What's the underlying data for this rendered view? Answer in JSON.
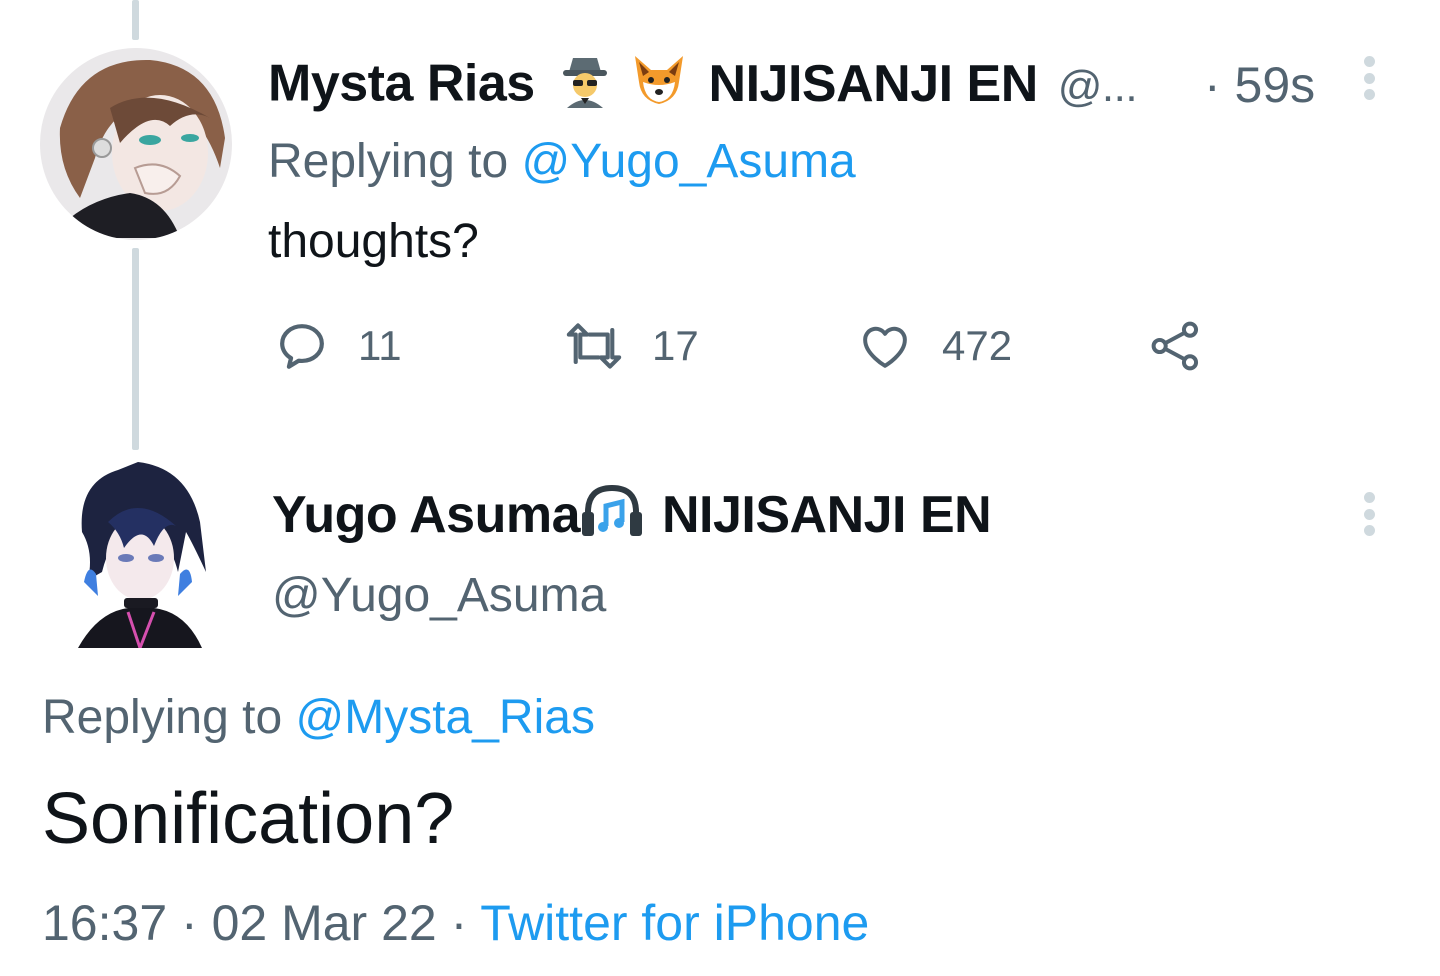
{
  "parent_tweet": {
    "display_name": "Mysta Rias",
    "org": "NIJISANJI EN",
    "handle_truncated": "@...",
    "time": "· 59s",
    "emoji_icons": [
      "detective-icon",
      "fox-face-icon"
    ],
    "replying_prefix": "Replying to",
    "replying_handle": "@Yugo_Asuma",
    "text": "thoughts?",
    "actions": {
      "replies": "11",
      "retweets": "17",
      "likes": "472"
    }
  },
  "main_tweet": {
    "display_name": "Yugo Asuma",
    "org": "NIJISANJI EN",
    "emoji_icons": [
      "headphone-icon"
    ],
    "handle": "@Yugo_Asuma",
    "replying_prefix": "Replying to",
    "replying_handle": "@Mysta_Rias",
    "text": "Sonification?",
    "time": "16:37",
    "date": "02 Mar 22",
    "source": "Twitter for iPhone",
    "separator": "·"
  },
  "colors": {
    "link": "#1d9bf0",
    "muted": "#536471",
    "text": "#0f1419",
    "thread_line": "#cfd9de"
  }
}
